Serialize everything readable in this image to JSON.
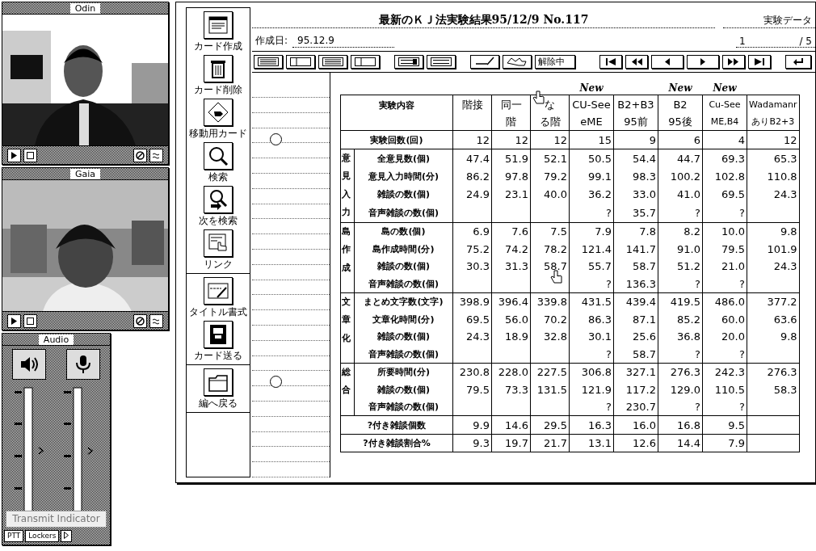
{
  "video_windows": [
    {
      "title": "Odin"
    },
    {
      "title": "Gaia"
    }
  ],
  "audio": {
    "title": "Audio",
    "transmit_indicator": {
      "label": "Transmit Indicator",
      "disabled": true
    },
    "buttons": [
      "PTT",
      "Lockers"
    ]
  },
  "palette": [
    [
      {
        "kind": "card-new",
        "label": "カード作成"
      },
      {
        "kind": "trash",
        "label": "カード削除"
      },
      {
        "kind": "hand-card",
        "label": "移動用カード"
      },
      {
        "kind": "search",
        "label": "検索"
      },
      {
        "kind": "search-next",
        "label": "次を検索"
      },
      {
        "kind": "link",
        "label": "リンク"
      }
    ],
    [
      {
        "kind": "title-format",
        "label": "タイトル書式"
      },
      {
        "kind": "send",
        "label": "カード送る"
      }
    ],
    [
      {
        "kind": "folder",
        "label": "編へ戻る"
      }
    ]
  ],
  "card": {
    "title": "最新のＫＪ法実験結果95/12/9 No.117",
    "category": "実験データ",
    "date_label": "作成日:",
    "date": "95.12.9",
    "page": "1",
    "page_total": "/ 5"
  },
  "toolbar": {
    "release_button": "解除中"
  },
  "table": {
    "heading": "実験内容",
    "columns": [
      {
        "top": "階接"
      },
      {
        "top": "同一",
        "bottom": "階"
      },
      {
        "top": "な",
        "bottom": "る階"
      },
      {
        "top": "CU-See",
        "bottom": "eME",
        "badge": "New"
      },
      {
        "top": "B2+B3",
        "bottom": "95前"
      },
      {
        "top": "B2",
        "bottom": "95後",
        "badge": "New"
      },
      {
        "top": "Cu-See",
        "bottom": "ME,B4",
        "badge": "New"
      },
      {
        "top": "Wadamanr",
        "bottom": "ありB2+3"
      }
    ],
    "count_row": {
      "label": "実験回数(回)",
      "values": [
        "12",
        "12",
        "12",
        "15",
        "9",
        "6",
        "4",
        "12"
      ]
    },
    "groups": [
      {
        "label": "意見入力",
        "rows": [
          {
            "label": "全意見数(個)",
            "values": [
              "47.4",
              "51.9",
              "52.1",
              "50.5",
              "54.4",
              "44.7",
              "69.3",
              "65.3"
            ]
          },
          {
            "label": "意見入力時間(分)",
            "values": [
              "86.2",
              "97.8",
              "79.2",
              "99.1",
              "98.3",
              "100.2",
              "102.8",
              "110.8"
            ]
          },
          {
            "label": "雑談の数(個)",
            "values": [
              "24.9",
              "23.1",
              "40.0",
              "36.2",
              "33.0",
              "41.0",
              "69.5",
              "24.3"
            ]
          },
          {
            "label": "音声雑談の数(個)",
            "values": [
              {
                "empty": true
              },
              {
                "empty": true
              },
              {
                "empty": true
              },
              "?",
              "35.7",
              "?",
              "?",
              {
                "empty": true
              }
            ]
          }
        ]
      },
      {
        "label": "島作成",
        "rows": [
          {
            "label": "島の数(個)",
            "values": [
              "6.9",
              "7.6",
              "7.5",
              "7.9",
              "7.8",
              "8.2",
              "10.0",
              "9.8"
            ]
          },
          {
            "label": "島作成時間(分)",
            "values": [
              "75.2",
              "74.2",
              "78.2",
              "121.4",
              "141.7",
              "91.0",
              "79.5",
              "101.9"
            ]
          },
          {
            "label": "雑談の数(個)",
            "values": [
              "30.3",
              "31.3",
              "58.7",
              "55.7",
              "58.7",
              "51.2",
              "21.0",
              "24.3"
            ]
          },
          {
            "label": "音声雑談の数(個)",
            "values": [
              {
                "empty": true
              },
              {
                "empty": true
              },
              {
                "empty": true
              },
              "?",
              "136.3",
              "?",
              "?",
              {
                "empty": true
              }
            ]
          }
        ]
      },
      {
        "label": "文章化",
        "rows": [
          {
            "label": "まとめ文字数(文字)",
            "values": [
              "398.9",
              "396.4",
              "339.8",
              "431.5",
              "439.4",
              "419.5",
              "486.0",
              "377.2"
            ]
          },
          {
            "label": "文章化時間(分)",
            "values": [
              "69.5",
              "56.0",
              "70.2",
              "86.3",
              "87.1",
              "85.2",
              "60.0",
              "63.6"
            ]
          },
          {
            "label": "雑談の数(個)",
            "values": [
              "24.3",
              "18.9",
              "32.8",
              "30.1",
              "25.6",
              "36.8",
              "20.0",
              "9.8"
            ]
          },
          {
            "label": "音声雑談の数(個)",
            "values": [
              {
                "empty": true
              },
              {
                "empty": true
              },
              {
                "empty": true
              },
              "?",
              "58.7",
              "?",
              "?",
              {
                "empty": true
              }
            ]
          }
        ]
      },
      {
        "label": "総合",
        "rows": [
          {
            "label": "所要時間(分)",
            "values": [
              "230.8",
              "228.0",
              "227.5",
              "306.8",
              "327.1",
              "276.3",
              "242.3",
              "276.3"
            ]
          },
          {
            "label": "雑談の数(個)",
            "values": [
              "79.5",
              "73.3",
              "131.5",
              "121.9",
              "117.2",
              "129.0",
              "110.5",
              "58.3"
            ]
          },
          {
            "label": "音声雑談の数(個)",
            "values": [
              {
                "empty": true
              },
              {
                "empty": true
              },
              {
                "empty": true
              },
              "?",
              "230.7",
              "?",
              "?",
              {
                "empty": true
              }
            ]
          }
        ]
      }
    ],
    "footer_rows": [
      {
        "label": "?付き雑談個数",
        "values": [
          "9.9",
          "14.6",
          "29.5",
          "16.3",
          "16.0",
          "16.8",
          "9.5",
          {
            "empty": true
          }
        ]
      },
      {
        "label": "?付き雑談割合%",
        "values": [
          "9.3",
          "19.7",
          "21.7",
          "13.1",
          "12.6",
          "14.4",
          "7.9",
          {
            "empty": true
          }
        ]
      }
    ]
  }
}
